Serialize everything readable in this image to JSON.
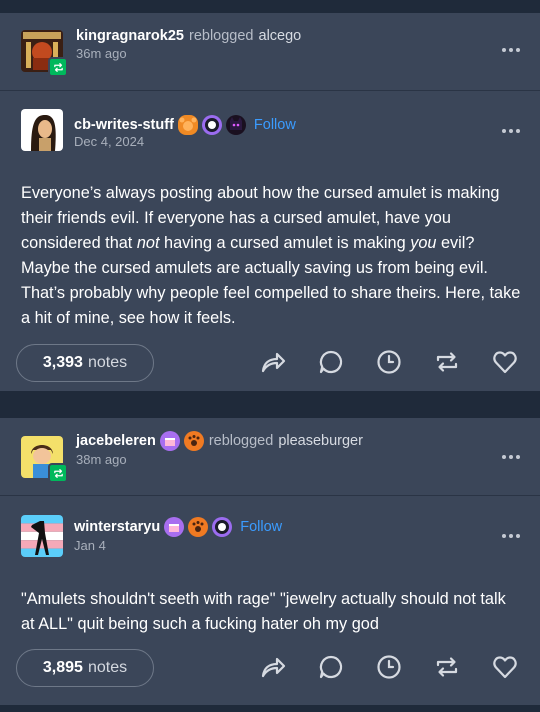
{
  "post1": {
    "reblogger": {
      "username": "kingragnarok25",
      "action": "reblogged",
      "source": "alcego",
      "time": "36m ago"
    },
    "author": {
      "username": "cb-writes-stuff",
      "follow_label": "Follow",
      "date": "Dec 4, 2024"
    },
    "body": {
      "part1": "Everyone’s always posting about how the cursed amulet is making their friends evil. If everyone has a cursed amulet, have you considered that ",
      "em1": "not",
      "part2": " having a cursed amulet is making ",
      "em2": "you",
      "part3": " evil? Maybe the cursed amulets are actually saving us from being evil. That’s probably why people feel compelled to share theirs. Here, take a hit of mine, see how it feels."
    },
    "notes": {
      "count": "3,393",
      "label": "notes"
    }
  },
  "post2": {
    "reblogger": {
      "username": "jacebeleren",
      "action": "reblogged",
      "source": "pleaseburger",
      "time": "38m ago"
    },
    "author": {
      "username": "winterstaryu",
      "follow_label": "Follow",
      "date": "Jan 4"
    },
    "body": {
      "text": "\"Amulets shouldn't seeth with rage\" \"jewelry actually should not talk at ALL\" quit being such a fucking hater oh my god"
    },
    "notes": {
      "count": "3,895",
      "label": "notes"
    }
  },
  "colors": {
    "page_bg": "#1f2a3a",
    "post_bg": "#3b4659",
    "follow_blue": "#3b9cff",
    "reblog_green": "#00b85c"
  },
  "icons": [
    "share-icon",
    "reply-icon",
    "clock-icon",
    "reblog-icon",
    "heart-icon",
    "more-options-icon"
  ]
}
